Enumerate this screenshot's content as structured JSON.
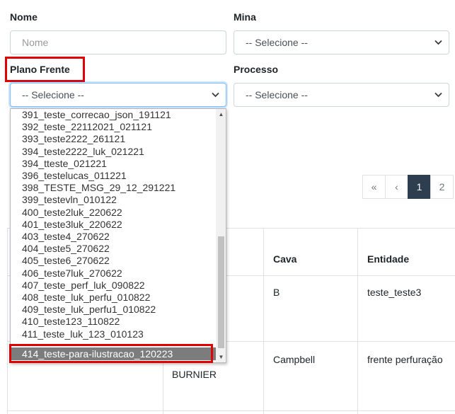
{
  "form": {
    "nome_label": "Nome",
    "nome_placeholder": "Nome",
    "mina_label": "Mina",
    "mina_value": "-- Selecione --",
    "plano_label": "Plano Frente",
    "plano_value": "-- Selecione --",
    "processo_label": "Processo",
    "processo_value": "-- Selecione --"
  },
  "pagination": {
    "first": "«",
    "prev": "‹",
    "pages": [
      "1",
      "2"
    ],
    "active": "1"
  },
  "table": {
    "headers": {
      "cava": "Cava",
      "entidade": "Entidade"
    },
    "row1": {
      "cava": "B",
      "entidade": "teste_teste3"
    },
    "row2": {
      "partial": "BURNIER",
      "cava": "Campbell",
      "entidade": "frente perfuração"
    }
  },
  "dropdown": {
    "options": [
      "391_teste_correcao_json_191121",
      "392_teste_22112021_021121",
      "393_teste2222_261121",
      "394_teste2222_luk_021221",
      "394_tteste_021221",
      "396_testelucas_011221",
      "398_TESTE_MSG_29_12_291221",
      "399_testevln_010122",
      "400_teste2luk_220622",
      "401_teste3luk_220622",
      "403_teste4_270622",
      "404_teste5_270622",
      "405_teste6_270622",
      "406_teste7luk_270622",
      "407_teste_perf_luk_090822",
      "408_teste_luk_perfu_010822",
      "409_teste_luk_perfu1_010822",
      "410_teste123_110822",
      "411_teste_luk_123_010123",
      "414_teste-para-ilustracao_120223"
    ],
    "selected_index": 19
  },
  "colors": {
    "highlight": "#e00000",
    "active_page": "#2c3e50",
    "selected_option": "#7c7c7c"
  }
}
